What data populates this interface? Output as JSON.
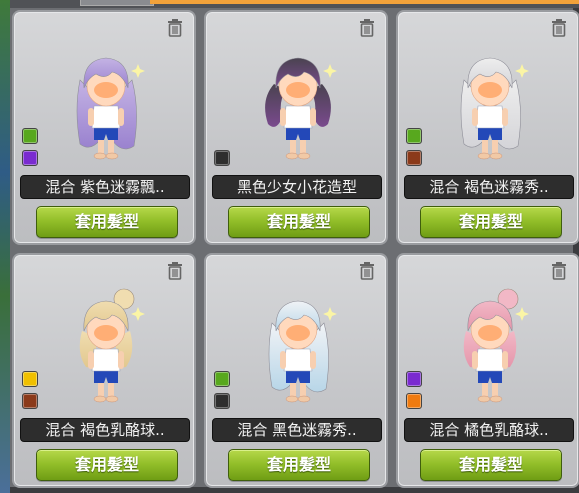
{
  "cards": [
    {
      "label": "混合  紫色迷霧飄..",
      "button": "套用髮型",
      "hair_color": "#c4b3e4",
      "hair_tip": "#9a82cf",
      "style": "long",
      "swatches": [
        "#58a81e",
        "#7a2bd0"
      ],
      "icons": [
        "trash-icon"
      ]
    },
    {
      "label": "黑色少女小花造型",
      "button": "套用髮型",
      "hair_color": "#4a4350",
      "hair_tip": "#7a4a8e",
      "style": "pigtails",
      "swatches": [
        "#2e2e2e"
      ],
      "icons": [
        "trash-icon"
      ]
    },
    {
      "label": "混合  褐色迷霧秀..",
      "button": "套用髮型",
      "hair_color": "#eeeeee",
      "hair_tip": "#d4d4d8",
      "style": "long",
      "swatches": [
        "#58a81e",
        "#8b3a1a"
      ],
      "icons": [
        "trash-icon"
      ]
    },
    {
      "label": "混合  褐色乳酪球..",
      "button": "套用髮型",
      "hair_color": "#f0ddb0",
      "hair_tip": "#e2c88f",
      "style": "bun",
      "swatches": [
        "#f0c000",
        "#8b3a1a"
      ],
      "icons": [
        "trash-icon"
      ]
    },
    {
      "label": "混合  黑色迷霧秀..",
      "button": "套用髮型",
      "hair_color": "#f1f3f6",
      "hair_tip": "#b8d6e8",
      "style": "long",
      "swatches": [
        "#58a81e",
        "#2e2e2e"
      ],
      "icons": [
        "trash-icon"
      ]
    },
    {
      "label": "混合  橘色乳酪球..",
      "button": "套用髮型",
      "hair_color": "#f2b8c6",
      "hair_tip": "#e596ab",
      "style": "bun",
      "swatches": [
        "#7a2bd0",
        "#f07b10"
      ],
      "icons": [
        "trash-icon"
      ]
    }
  ],
  "colors": {
    "button_green": "#93bf2a",
    "label_bg": "#2d2d2d",
    "accent_orange": "#f2a23a"
  }
}
